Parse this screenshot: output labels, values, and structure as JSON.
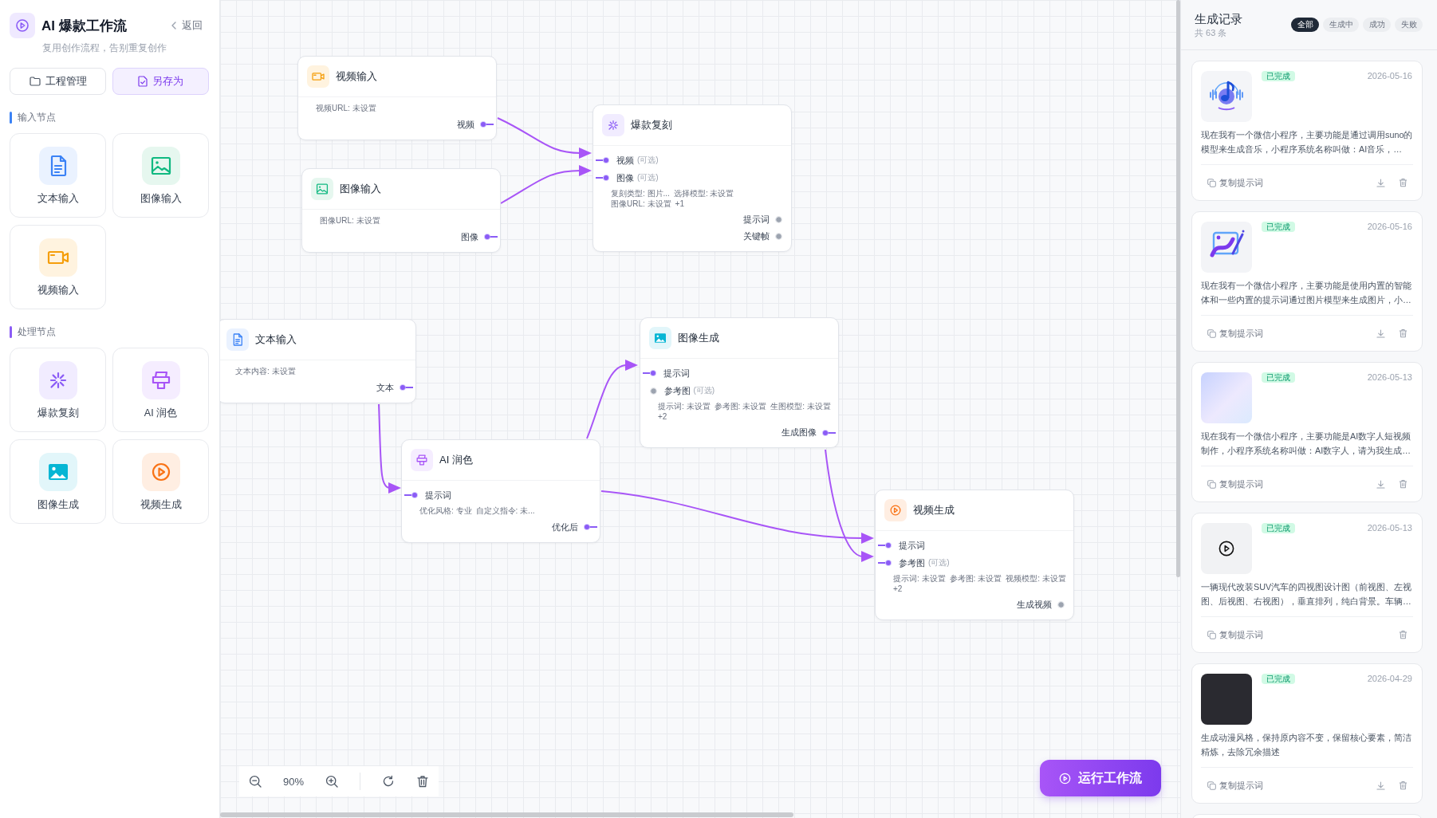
{
  "sidebar": {
    "title": "AI 爆款工作流",
    "subtitle": "复用创作流程，告别重复创作",
    "back_label": "返回",
    "actions": [
      {
        "label": "工程管理",
        "kind": "folder",
        "primary": false
      },
      {
        "label": "另存为",
        "kind": "save",
        "primary": true
      }
    ],
    "sections": [
      {
        "title": "输入节点",
        "kind": "input",
        "items": [
          {
            "label": "文本输入",
            "kind": "text"
          },
          {
            "label": "图像输入",
            "kind": "image"
          },
          {
            "label": "视频输入",
            "kind": "video"
          }
        ]
      },
      {
        "title": "处理节点",
        "kind": "process",
        "items": [
          {
            "label": "爆款复刻",
            "kind": "remix"
          },
          {
            "label": "AI 润色",
            "kind": "polish"
          },
          {
            "label": "图像生成",
            "kind": "imagegen"
          },
          {
            "label": "视频生成",
            "kind": "videogen"
          }
        ]
      }
    ]
  },
  "canvas": {
    "nodes": [
      {
        "title": "视频输入",
        "kind": "video",
        "param_lines": [
          [
            "视频URL: 未设置"
          ]
        ],
        "outputs": [
          {
            "label": "视频",
            "connected": true
          }
        ]
      },
      {
        "title": "图像输入",
        "kind": "image",
        "param_lines": [
          [
            "图像URL: 未设置"
          ]
        ],
        "outputs": [
          {
            "label": "图像",
            "connected": true
          }
        ]
      },
      {
        "title": "爆款复刻",
        "kind": "remix",
        "inputs": [
          {
            "label": "视频",
            "note": "(可选)",
            "connected": true
          },
          {
            "label": "图像",
            "note": "(可选)",
            "connected": true
          }
        ],
        "param_lines": [
          [
            "复刻类型: 图片...",
            "选择模型: 未设置"
          ],
          [
            "图像URL: 未设置",
            "+1"
          ]
        ],
        "outputs": [
          {
            "label": "提示词",
            "connected": false
          },
          {
            "label": "关键帧",
            "connected": false
          }
        ]
      },
      {
        "title": "文本输入",
        "kind": "text",
        "param_lines": [
          [
            "文本内容: 未设置"
          ]
        ],
        "outputs": [
          {
            "label": "文本",
            "connected": true
          }
        ]
      },
      {
        "title": "AI 润色",
        "kind": "polish",
        "inputs": [
          {
            "label": "提示词",
            "connected": true
          }
        ],
        "param_lines": [
          [
            "优化风格: 专业",
            "自定义指令: 未..."
          ]
        ],
        "outputs": [
          {
            "label": "优化后",
            "connected": true
          }
        ]
      },
      {
        "title": "图像生成",
        "kind": "imagegen",
        "inputs": [
          {
            "label": "提示词",
            "connected": true
          },
          {
            "label": "参考图",
            "note": "(可选)",
            "connected": false
          }
        ],
        "param_lines": [
          [
            "提示词: 未设置",
            "参考图: 未设置",
            "生图模型: 未设置"
          ],
          [
            "+2"
          ]
        ],
        "outputs": [
          {
            "label": "生成图像",
            "connected": true
          }
        ]
      },
      {
        "title": "视频生成",
        "kind": "videogen",
        "inputs": [
          {
            "label": "提示词",
            "connected": true
          },
          {
            "label": "参考图",
            "note": "(可选)",
            "connected": true
          }
        ],
        "param_lines": [
          [
            "提示词: 未设置",
            "参考图: 未设置",
            "视频模型: 未设置"
          ],
          [
            "+2"
          ]
        ],
        "outputs": [
          {
            "label": "生成视频",
            "connected": false
          }
        ]
      }
    ],
    "toolbar": {
      "zoom": "90%"
    },
    "run_button": {
      "label": "运行工作流"
    }
  },
  "history": {
    "title": "生成记录",
    "count": "共 63 条",
    "filters": [
      {
        "label": "全部",
        "selected": true
      },
      {
        "label": "生成中",
        "selected": false
      },
      {
        "label": "成功",
        "selected": false
      },
      {
        "label": "失败",
        "selected": false
      }
    ],
    "records": [
      {
        "thumbnail": {
          "kind": "music"
        },
        "status": {
          "label": "已完成",
          "kind": "done"
        },
        "date": "2026-05-16",
        "prompt": "现在我有一个微信小程序，主要功能是通过调用suno的模型来生成音乐，小程序系统名称叫做：AI音乐，…",
        "copy_label": "复制提示词",
        "download": true
      },
      {
        "thumbnail": {
          "kind": "design"
        },
        "status": {
          "label": "已完成",
          "kind": "done"
        },
        "date": "2026-05-16",
        "prompt": "现在我有一个微信小程序，主要功能是使用内置的智能体和一些内置的提示词通过图片模型来生成图片，小…",
        "copy_label": "复制提示词",
        "download": true
      },
      {
        "thumbnail": {
          "kind": "portrait"
        },
        "status": {
          "label": "已完成",
          "kind": "done"
        },
        "date": "2026-05-13",
        "prompt": "现在我有一个微信小程序，主要功能是AI数字人短视频制作，小程序系统名称叫做：AI数字人，请为我生成…",
        "copy_label": "复制提示词",
        "download": true
      },
      {
        "thumbnail": {
          "kind": "video"
        },
        "status": {
          "label": "已完成",
          "kind": "done"
        },
        "date": "2026-05-13",
        "prompt": "一辆现代改装SUV汽车的四视图设计图（前视图、左视图、后视图、右视图），垂直排列，纯白背景。车辆…",
        "copy_label": "复制提示词",
        "download": false
      },
      {
        "thumbnail": {
          "kind": "illustration"
        },
        "status": {
          "label": "已完成",
          "kind": "done"
        },
        "date": "2026-04-29",
        "prompt": "生成动漫风格，保持原内容不变，保留核心要素，简洁精炼，去除冗余描述",
        "copy_label": "复制提示词",
        "download": true
      }
    ]
  }
}
